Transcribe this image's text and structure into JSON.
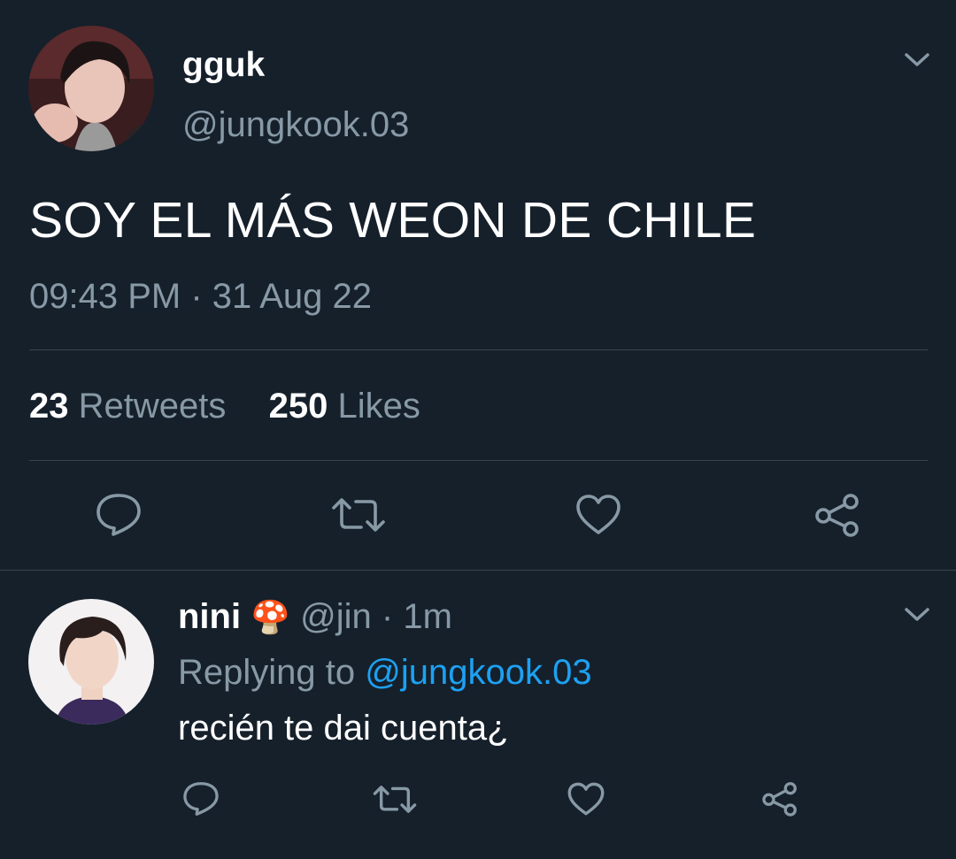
{
  "main_tweet": {
    "display_name": "gguk",
    "handle": "@jungkook.03",
    "text": "SOY EL MÁS WEON DE CHILE",
    "time": "09:43 PM",
    "separator": "·",
    "date": "31 Aug 22",
    "retweets_count": "23",
    "retweets_label": "Retweets",
    "likes_count": "250",
    "likes_label": "Likes",
    "actions": [
      "reply-icon",
      "retweet-icon",
      "like-icon",
      "share-icon"
    ]
  },
  "reply": {
    "display_name": "nini",
    "emoji": "🍄",
    "handle": "@jin",
    "separator": "·",
    "time": "1m",
    "replying_prefix": "Replying to",
    "replying_handle": "@jungkook.03",
    "text": "recién te dai cuenta¿",
    "actions": [
      "reply-icon",
      "retweet-icon",
      "like-icon",
      "share-icon"
    ]
  },
  "colors": {
    "background": "#15202b",
    "text": "#ffffff",
    "muted": "#8899a6",
    "divider": "#38444d",
    "link": "#1da1f2"
  }
}
